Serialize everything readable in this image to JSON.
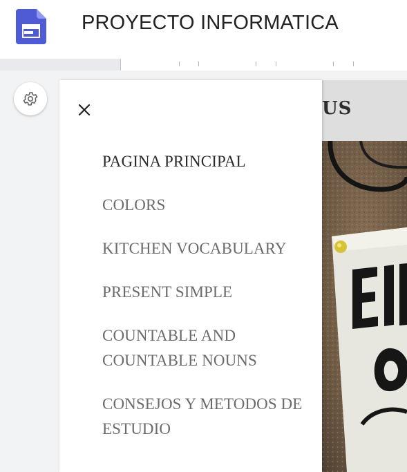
{
  "app": {
    "title": "PROYECTO INFORMATICA",
    "logo_icon": "google-sites-icon",
    "accent_color": "#4f5bd5"
  },
  "toolbar": {
    "settings_icon": "gear-icon"
  },
  "site": {
    "header_title_partial": "US",
    "header_bg": "#dedede",
    "hero_image": "cork-board-sticky-note-photo"
  },
  "drawer": {
    "close_icon": "close-icon",
    "items": [
      {
        "label": "PAGINA PRINCIPAL",
        "active": true
      },
      {
        "label": "COLORS",
        "active": false
      },
      {
        "label": "KITCHEN VOCABULARY",
        "active": false
      },
      {
        "label": "PRESENT SIMPLE",
        "active": false
      },
      {
        "label": "COUNTABLE AND COUNTABLE NOUNS",
        "active": false
      },
      {
        "label": "CONSEJOS Y METODOS DE ESTUDIO",
        "active": false
      }
    ]
  }
}
